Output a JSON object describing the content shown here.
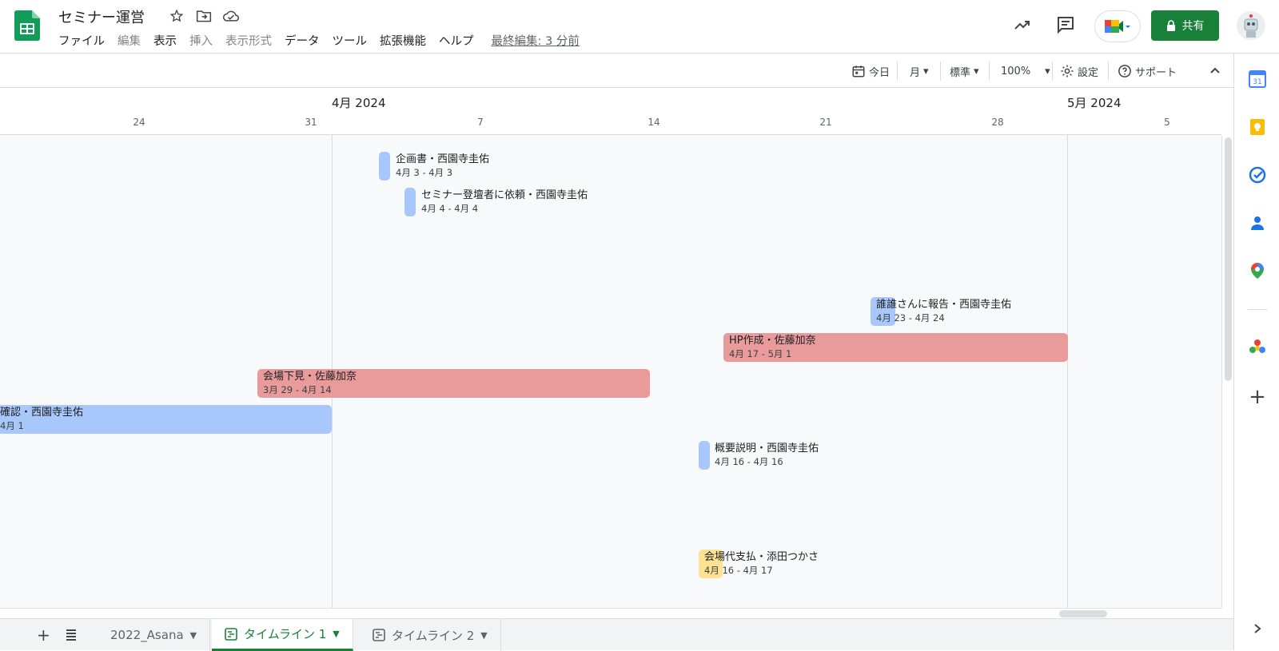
{
  "doc": {
    "title": "セミナー運営",
    "menu": [
      "ファイル",
      "編集",
      "表示",
      "挿入",
      "表示形式",
      "データ",
      "ツール",
      "拡張機能",
      "ヘルプ"
    ],
    "last_edit": "最終編集: 3 分前",
    "share_label": "共有"
  },
  "toolbar": {
    "today": "今日",
    "view": "月",
    "density": "標準",
    "zoom": "100%",
    "settings": "設定",
    "support": "サポート"
  },
  "timeline": {
    "months": [
      "4月 2024",
      "5月 2024"
    ],
    "weeks": [
      "24",
      "31",
      "7",
      "14",
      "21",
      "28",
      "5"
    ],
    "tasks": [
      {
        "title": "企画書・西園寺圭佑",
        "dates": "4月 3 - 4月 3",
        "color": "#a8c7fa"
      },
      {
        "title": "セミナー登壇者に依頼・西園寺圭佑",
        "dates": "4月 4 - 4月 4",
        "color": "#a8c7fa"
      },
      {
        "title": "誰誰さんに報告・西園寺圭佑",
        "dates": "4月 23 - 4月 24",
        "color": "#a8c7fa"
      },
      {
        "title": "HP作成・佐藤加奈",
        "dates": "4月 17 - 5月 1",
        "color": "#e99b9b"
      },
      {
        "title": "会場下見・佐藤加奈",
        "dates": "3月 29 - 4月 14",
        "color": "#e99b9b"
      },
      {
        "title": "確認・西園寺圭佑",
        "dates": "4月 1",
        "color": "#a8c7fa"
      },
      {
        "title": "概要説明・西園寺圭佑",
        "dates": "4月 16 - 4月 16",
        "color": "#a8c7fa"
      },
      {
        "title": "会場代支払・添田つかさ",
        "dates": "4月 16 - 4月 17",
        "color": "#fde293"
      }
    ]
  },
  "sheet_tabs": [
    {
      "label": "2022_Asana"
    },
    {
      "label": "タイムライン 1",
      "active": true
    },
    {
      "label": "タイムライン 2"
    }
  ],
  "side_panel": [
    "calendar-icon",
    "keep-icon",
    "tasks-icon",
    "contacts-icon",
    "maps-icon",
    "addon-icon",
    "add-icon"
  ]
}
